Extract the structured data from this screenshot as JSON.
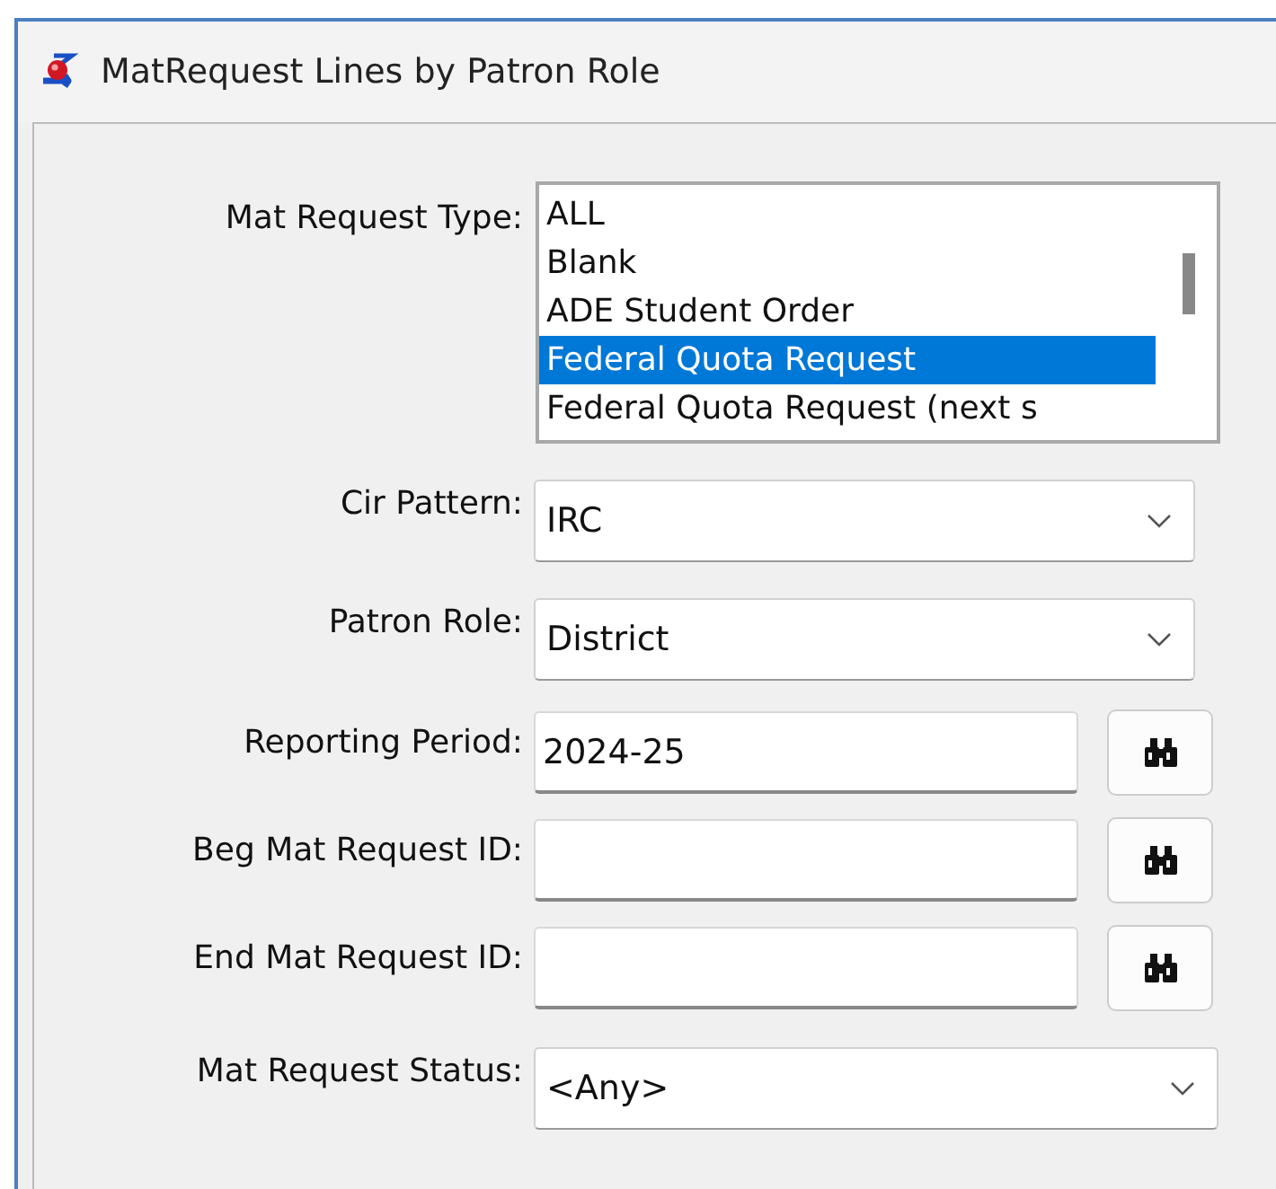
{
  "window": {
    "title": "MatRequest Lines by Patron Role"
  },
  "mat_request_type": {
    "label": "Mat Request Type:",
    "items": [
      {
        "text": "ALL",
        "selected": false
      },
      {
        "text": "Blank",
        "selected": false
      },
      {
        "text": "ADE Student Order",
        "selected": false
      },
      {
        "text": "Federal Quota Request",
        "selected": true
      },
      {
        "text": "Federal Quota Request (next s",
        "selected": false
      }
    ]
  },
  "cir_pattern": {
    "label": "Cir Pattern:",
    "value": "IRC"
  },
  "patron_role": {
    "label": "Patron Role:",
    "value": "District"
  },
  "lookup_fields": [
    {
      "label": "Reporting Period:",
      "value": "2024-25"
    },
    {
      "label": "Beg Mat Request ID:"
    },
    {
      "label": "End Mat Request ID:"
    }
  ],
  "mat_request_status": {
    "label": "Mat Request Status:",
    "value": "<Any>"
  }
}
